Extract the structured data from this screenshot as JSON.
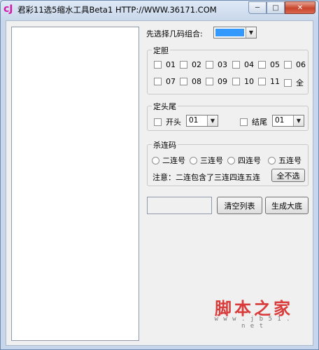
{
  "window": {
    "title": "君彩11选5缩水工具Beta1 HTTP://WWW.36171.COM",
    "icon_label": "cJ",
    "minimize_glyph": "─",
    "maximize_glyph": "□",
    "close_glyph": "✕"
  },
  "combo_select": {
    "label": "先选择几码组合:",
    "value": ""
  },
  "group_dingdan": {
    "title": "定胆",
    "items": [
      "01",
      "02",
      "03",
      "04",
      "05",
      "06",
      "07",
      "08",
      "09",
      "10",
      "11",
      "全"
    ]
  },
  "group_head_tail": {
    "title": "定头尾",
    "head_label": "开头",
    "head_value": "01",
    "tail_label": "结尾",
    "tail_value": "01"
  },
  "group_kill": {
    "title": "杀连码",
    "options": [
      "二连号",
      "三连号",
      "四连号",
      "五连号"
    ],
    "note": "注意：二连包含了三连四连五连",
    "none_button": "全不选"
  },
  "actions": {
    "clear_button": "清空列表",
    "generate_button": "生成大底"
  },
  "watermark": {
    "text": "脚本之家",
    "url": "w w w . j b 5 1 . n e t"
  },
  "colors": {
    "titlebar": "#c7d6ea",
    "selection": "#3399ff",
    "watermark": "#d93a3a"
  }
}
